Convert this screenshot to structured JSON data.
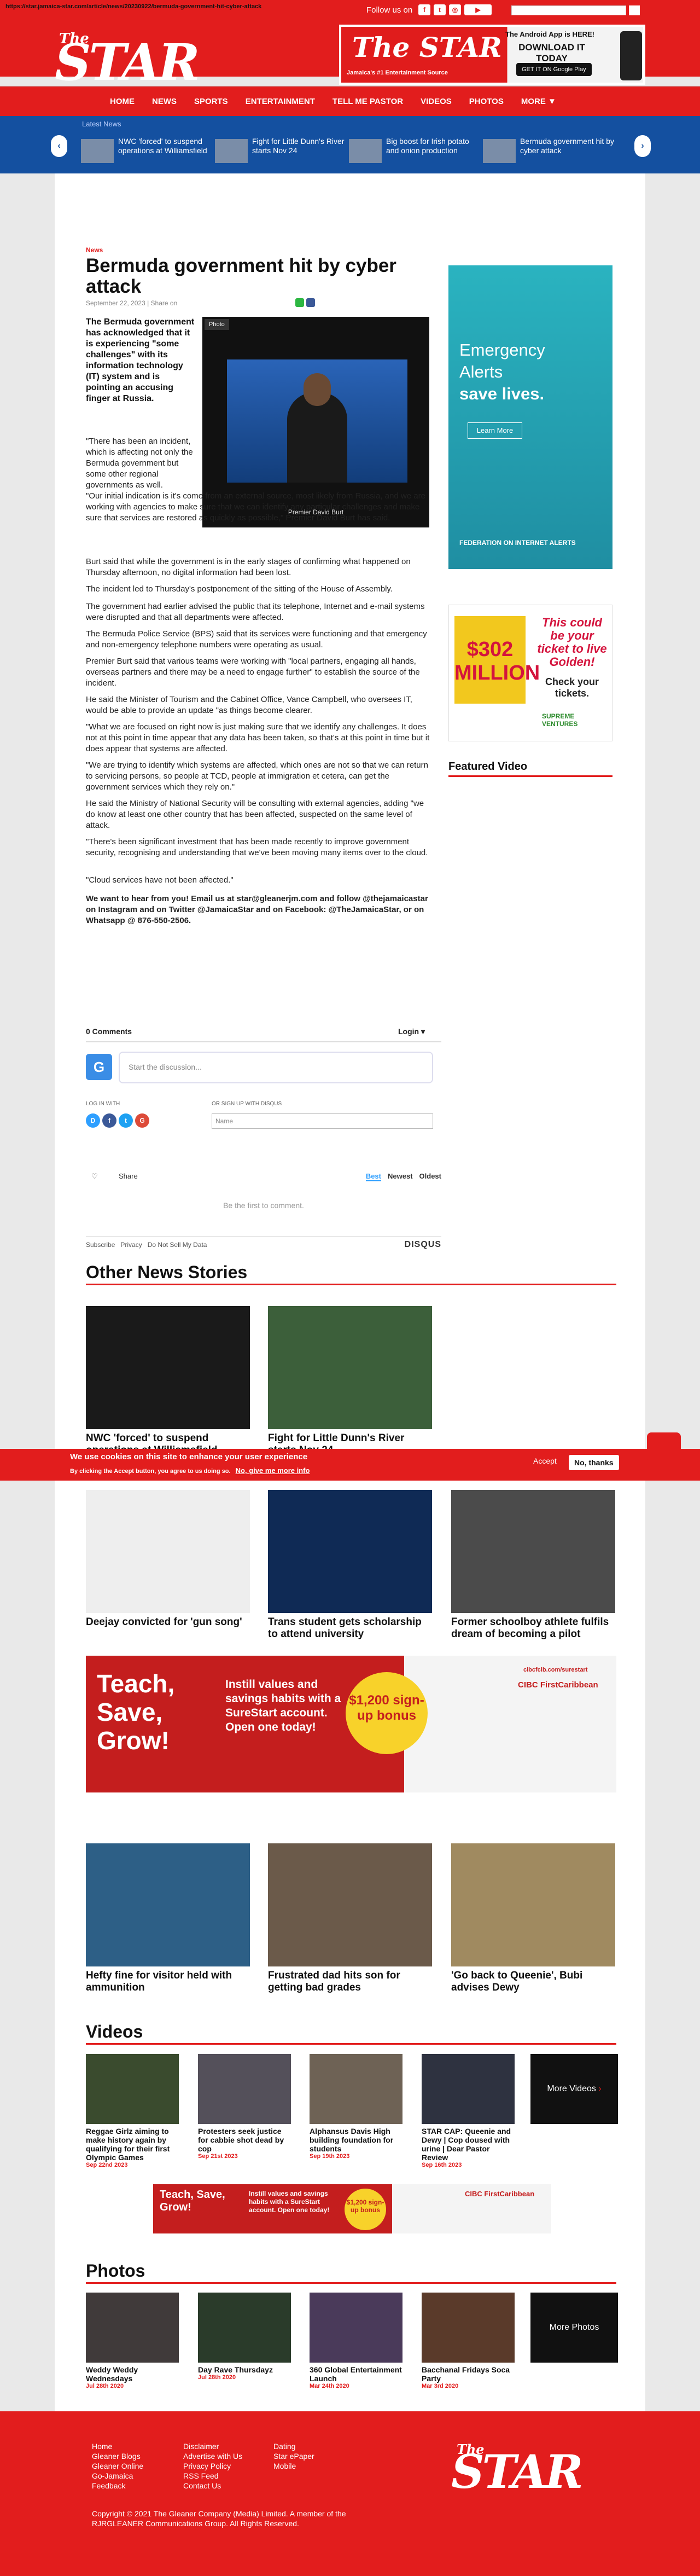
{
  "url": {
    "text": "https://star.jamaica-star.com/article/news/20230922/bermuda-government-hit-cyber-attack"
  },
  "header": {
    "follow_us": "Follow us on",
    "logo_the": "The",
    "logo_star": "STAR",
    "app_ad": {
      "line1": "The Android App is HERE!",
      "line2": "DOWNLOAD IT TODAY",
      "store": "GET IT ON Google Play",
      "brand": "The STAR",
      "sub": "Jamaica's #1 Entertainment Source"
    }
  },
  "nav": {
    "items": [
      "HOME",
      "NEWS",
      "SPORTS",
      "ENTERTAINMENT",
      "TELL ME PASTOR",
      "VIDEOS",
      "PHOTOS",
      "MORE ▼"
    ]
  },
  "ticker": {
    "label": "Latest News",
    "items": [
      "NWC 'forced' to suspend operations at Williamsfield",
      "Fight for Little Dunn's River starts Nov 24",
      "Big boost for Irish potato and onion production",
      "Bermuda government hit by cyber attack"
    ]
  },
  "article": {
    "category": "News",
    "headline": "Bermuda government hit by cyber attack",
    "date": "September 22, 2023",
    "share": "Share on",
    "lede": "The Bermuda government has acknowledged that it is experiencing \"some challenges\" with its information technology (IT) system and is pointing an accusing finger at Russia.",
    "photo_tab": "Photo",
    "photo_caption": "Premier David Burt",
    "p1": "\"There has been an incident, which is affecting not only the Bermuda government but some other regional governments as well.",
    "p2": "\"Our initial indication is it's come from an external source, most likely from Russia, and we are working with agencies to make sure that we can identify any particular challenges and make sure that services are restored as quickly as possible,\" Premier David Burt has said.",
    "p3": "Burt said that while the government is in the early stages of confirming what happened on Thursday afternoon, no digital information had been lost.",
    "p4": "The incident led to Thursday's postponement of the sitting of the House of Assembly.",
    "p5": "The government had earlier advised the public that its telephone, Internet and e-mail systems were disrupted and that all departments were affected.",
    "p6": "The Bermuda Police Service  (BPS) said that its services were functioning and that emergency and non-emergency telephone numbers were operating as usual.",
    "p7": "Premier Burt said that various teams were working with \"local partners, engaging all hands, overseas partners and there may be a need to engage further\" to establish the source of the incident.",
    "p8": "He said  the Minister of Tourism and the Cabinet Office, Vance Campbell, who oversees IT, would be able to provide an update \"as things become clearer.",
    "p9": "\"What we are focused on right now is just making sure that we identify any challenges. It does not at this point in time appear that any data has been taken, so that's at this point in time but it does appear that systems are affected.",
    "p10": "\"We are trying to identify which systems are affected, which ones are not so that we can return to servicing persons, so people at TCD, people at immigration et cetera, can get the government services which they rely on.\"",
    "p11": "He said the Ministry of National Security will be consulting with external agencies, adding \"we do know at least one other country that has been affected, suspected on the same level of attack.",
    "p12": "\"There's been significant investment that has been made recently to improve government security, recognising and understanding that we've been moving many items over to the cloud.",
    "p13": "\"Cloud services have not been affected.\"",
    "cta": "We want to hear from you! Email us at star@gleanerjm.com and follow @thejamaicastar on Instagram and on Twitter @JamaicaStar and on Facebook: @TheJamaicaStar, or on Whatsapp @ 876-550-2506."
  },
  "sidebar": {
    "ad1": {
      "line1": "Emergency",
      "line2": "Alerts",
      "line3": "save lives.",
      "button": "Learn More",
      "footer": "FEDERATION ON INTERNET ALERTS"
    },
    "ad2": {
      "amount": "$302 MILLION",
      "headline": "This could be your ticket to live Golden!",
      "sub": "Check your tickets.",
      "brand": "SUPREME VENTURES"
    },
    "featured_video": "Featured Video"
  },
  "comments": {
    "title": "0 Comments",
    "login": "Login ▾",
    "placeholder": "Start the discussion...",
    "log_in_with": "LOG IN WITH",
    "or_sign_up": "OR SIGN UP WITH DISQUS",
    "name_placeholder": "Name",
    "share": "Share",
    "sort_best": "Best",
    "sort_newest": "Newest",
    "sort_oldest": "Oldest",
    "first": "Be the first to comment.",
    "subscribe": "Subscribe",
    "privacy": "Privacy",
    "do_not_sell": "Do Not Sell My Data",
    "brand": "DISQUS"
  },
  "other_news": {
    "title": "Other News Stories",
    "stories": [
      "NWC 'forced' to suspend operations at Williamsfield",
      "Fight for Little Dunn's River starts Nov 24",
      "Deejay convicted for 'gun song'",
      "Trans student gets scholarship to attend university",
      "Former schoolboy athlete fulfils dream of becoming a pilot",
      "Hefty fine for visitor held with ammunition",
      "Frustrated dad hits son for getting bad grades",
      "'Go back to Queenie', Bubi advises Dewy"
    ]
  },
  "cookie": {
    "title": "We use cookies on this site to enhance your user experience",
    "text": "By clicking the Accept button, you agree to us doing so.",
    "link": "No, give me more info",
    "accept": "Accept",
    "no_thanks": "No, thanks"
  },
  "cibc_ad": {
    "teach": "Teach, Save, Grow!",
    "mid": "Instill values and savings habits with a SureStart account. Open one today!",
    "bonus": "$1,200 sign-up bonus",
    "brand": "CIBC FirstCaribbean",
    "url": "cibcfcib.com/surestart"
  },
  "videos": {
    "title": "Videos",
    "more": "More Videos",
    "items": [
      {
        "cap": "Reggae Girlz aiming to make history again by qualifying for their first Olympic Games",
        "date": "Sep 22nd 2023"
      },
      {
        "cap": "Protesters seek justice for cabbie shot dead by cop",
        "date": "Sep 21st 2023"
      },
      {
        "cap": "Alphansus Davis High building foundation for students",
        "date": "Sep 19th 2023"
      },
      {
        "cap": "STAR CAP: Queenie and Dewy | Cop doused with urine | Dear Pastor Review",
        "date": "Sep 16th 2023"
      }
    ]
  },
  "photos": {
    "title": "Photos",
    "more": "More Photos",
    "items": [
      {
        "cap": "Weddy Weddy Wednesdays",
        "date": "Jul 28th 2020"
      },
      {
        "cap": "Day Rave Thursdayz",
        "date": "Jul 28th 2020"
      },
      {
        "cap": "360 Global Entertainment Launch",
        "date": "Mar 24th 2020"
      },
      {
        "cap": "Bacchanal Fridays Soca Party",
        "date": "Mar 3rd 2020"
      }
    ]
  },
  "footer": {
    "col1": [
      "Home",
      "Gleaner Blogs",
      "Gleaner Online",
      "Go-Jamaica",
      "Feedback"
    ],
    "col2": [
      "Disclaimer",
      "Advertise with Us",
      "Privacy Policy",
      "RSS Feed",
      "Contact Us"
    ],
    "col3": [
      "Dating",
      "Star ePaper",
      "Mobile"
    ],
    "copyright": "Copyright © 2021 The Gleaner Company (Media) Limited. A member of the RJRGLEANER Communications Group. All Rights Reserved.",
    "logo_the": "The",
    "logo_star": "STAR"
  },
  "colors": {
    "brand_red": "#e21d1d",
    "ticker_blue": "#1450a0",
    "link_blue": "#2e9fff"
  }
}
